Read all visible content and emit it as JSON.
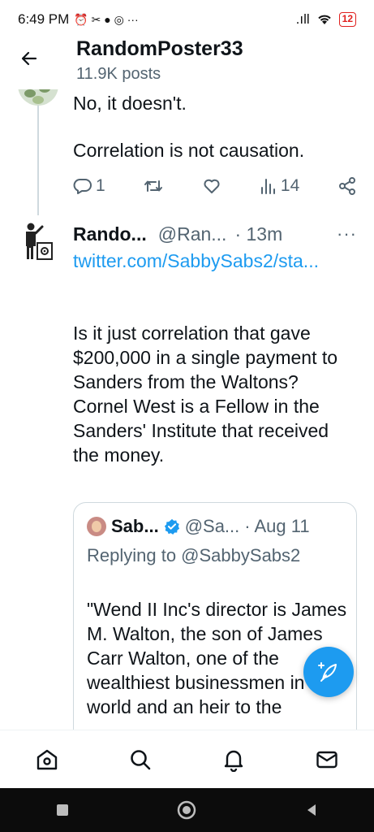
{
  "status_bar": {
    "time": "6:49 PM",
    "notif_icons": "⏰ ✂ ● ◎ ···",
    "signal": ".ıll",
    "battery": "12"
  },
  "header": {
    "title": "RandomPoster33",
    "subtitle": "11.9K posts"
  },
  "previous_tweet": {
    "lines": [
      "No, it doesn't.",
      "Correlation is not causation."
    ],
    "reply_count": "1",
    "views": "14"
  },
  "tweet": {
    "name": "Rando...",
    "handle": "@Ran...",
    "time": "· 13m",
    "more": "···",
    "link": "twitter.com/SabbySabs2/sta...",
    "body": "Is it just correlation that gave $200,000 in a single payment to Sanders from the Waltons? Cornel West is a Fellow in the Sanders' Institute that received the money."
  },
  "quote": {
    "name": "Sab...",
    "handle": "@Sa...",
    "time": "· Aug 11",
    "replying": "Replying to @SabbySabs2",
    "text": "\"Wend II Inc's director is James M. Walton, the son of James Carr Walton, one of the wealthiest businessmen in the world and an heir to the"
  },
  "colors": {
    "accent": "#1d9bf0",
    "text": "#0f1419",
    "muted": "#536471"
  },
  "icons": {
    "back": "arrow-left-icon",
    "reply": "reply-icon",
    "retweet": "retweet-icon",
    "like": "heart-icon",
    "views": "views-icon",
    "share": "share-icon",
    "compose": "compose-icon",
    "home": "home-icon",
    "search": "search-icon",
    "notifications": "bell-icon",
    "messages": "mail-icon"
  }
}
